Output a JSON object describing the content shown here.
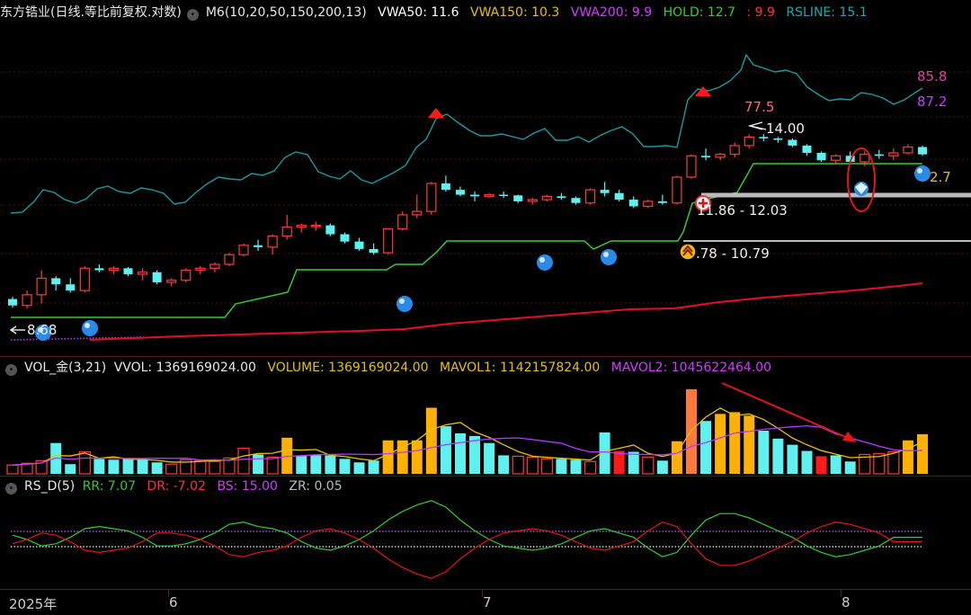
{
  "main_header": {
    "title": "东方锆业(日线.等比前复权.对数)",
    "m6": "M6(10,20,50,150,200,13)",
    "vwa50": "VWA50: 11.6",
    "vwa150": "VWA150: 10.3",
    "vwa200": "VWA200: 9.9",
    "hold": "HOLD: 12.7",
    "hold2": ": 9.9",
    "rsline": "RSLINE: 15.1",
    "colors": {
      "title": "#e8e8e8",
      "m6": "#e8e8e8",
      "vwa50": "#ffffff",
      "vwa150": "#e6c200",
      "vwa200": "#d23cff",
      "hold": "#33cc33",
      "hold2": "#ff3333",
      "rsline": "#1fa8a8"
    }
  },
  "vol_header": {
    "name": "VOL_金(3,21)",
    "vvol": "VVOL: 1369169024.00",
    "volume": "VOLUME: 1369169024.00",
    "mavol1": "MAVOL1: 1142157824.00",
    "mavol2": "MAVOL2: 1045622464.00",
    "colors": {
      "vvol": "#e8e8e8",
      "volume": "#e6c200",
      "mavol1": "#e6c200",
      "mavol2": "#d23cff"
    }
  },
  "rs_header": {
    "name": "RS_D(5)",
    "rr": "RR: 7.07",
    "dr": "DR: -7.02",
    "bs": "BS: 15.00",
    "zr": "ZR: 0.05",
    "colors": {
      "rr": "#33cc33",
      "dr": "#ff3333",
      "bs": "#d23cff",
      "zr": "#bbbbbb"
    }
  },
  "annotations": {
    "price_877": "77.5",
    "high_14": "14.00",
    "range_1": "11.86 - 12.03",
    "range_2": ".78 - 10.79",
    "low_868": "8.68",
    "rs_858": "85.8",
    "rs_872": "87.2",
    "right_27": "2.7"
  },
  "xaxis": {
    "labels": [
      "2025年",
      "6",
      "7",
      "8"
    ]
  },
  "chart_data": {
    "type": "candlestick",
    "candles": [
      [
        9.2,
        9.25,
        9.0,
        9.05
      ],
      [
        9.05,
        9.4,
        8.98,
        9.3
      ],
      [
        9.3,
        9.9,
        9.1,
        9.7
      ],
      [
        9.7,
        9.75,
        9.4,
        9.55
      ],
      [
        9.55,
        9.7,
        9.35,
        9.4
      ],
      [
        9.4,
        10.0,
        9.35,
        9.95
      ],
      [
        9.95,
        10.05,
        9.85,
        9.9
      ],
      [
        9.9,
        10.0,
        9.8,
        9.95
      ],
      [
        9.95,
        9.98,
        9.75,
        9.8
      ],
      [
        9.8,
        9.95,
        9.65,
        9.85
      ],
      [
        9.85,
        9.9,
        9.55,
        9.6
      ],
      [
        9.6,
        9.7,
        9.5,
        9.65
      ],
      [
        9.65,
        9.95,
        9.6,
        9.9
      ],
      [
        9.9,
        10.0,
        9.8,
        9.95
      ],
      [
        9.95,
        10.1,
        9.85,
        10.05
      ],
      [
        10.05,
        10.35,
        10.0,
        10.3
      ],
      [
        10.3,
        10.6,
        10.25,
        10.55
      ],
      [
        10.55,
        10.7,
        10.4,
        10.5
      ],
      [
        10.5,
        10.85,
        10.3,
        10.8
      ],
      [
        10.8,
        11.4,
        10.7,
        11.05
      ],
      [
        11.05,
        11.15,
        10.9,
        11.1
      ],
      [
        11.1,
        11.2,
        10.95,
        11.1
      ],
      [
        11.1,
        11.15,
        10.8,
        10.85
      ],
      [
        10.85,
        10.9,
        10.6,
        10.65
      ],
      [
        10.65,
        10.75,
        10.4,
        10.45
      ],
      [
        10.45,
        10.6,
        10.3,
        10.35
      ],
      [
        10.35,
        11.0,
        10.3,
        11.0
      ],
      [
        11.0,
        11.5,
        10.95,
        11.4
      ],
      [
        11.4,
        12.0,
        11.3,
        11.5
      ],
      [
        11.5,
        12.4,
        11.4,
        12.35
      ],
      [
        12.35,
        12.6,
        12.1,
        12.15
      ],
      [
        12.15,
        12.25,
        11.95,
        12.0
      ],
      [
        12.0,
        12.1,
        11.8,
        11.95
      ],
      [
        11.95,
        12.05,
        11.9,
        12.0
      ],
      [
        12.0,
        12.1,
        11.9,
        11.98
      ],
      [
        11.98,
        12.0,
        11.75,
        11.8
      ],
      [
        11.8,
        11.9,
        11.7,
        11.85
      ],
      [
        11.85,
        12.0,
        11.8,
        11.95
      ],
      [
        11.95,
        12.05,
        11.85,
        11.9
      ],
      [
        11.9,
        11.95,
        11.7,
        11.75
      ],
      [
        11.75,
        12.2,
        11.7,
        12.15
      ],
      [
        12.15,
        12.4,
        11.95,
        12.05
      ],
      [
        12.05,
        12.15,
        11.8,
        11.85
      ],
      [
        11.85,
        11.95,
        11.6,
        11.65
      ],
      [
        11.65,
        11.85,
        11.6,
        11.8
      ],
      [
        11.8,
        12.0,
        11.7,
        11.75
      ],
      [
        11.75,
        12.6,
        11.7,
        12.55
      ],
      [
        12.55,
        13.3,
        12.5,
        13.25
      ],
      [
        13.25,
        13.5,
        13.1,
        13.2
      ],
      [
        13.2,
        13.35,
        13.1,
        13.3
      ],
      [
        13.3,
        13.7,
        13.2,
        13.6
      ],
      [
        13.6,
        14.0,
        13.5,
        13.9
      ],
      [
        13.9,
        14.0,
        13.75,
        13.85
      ],
      [
        13.85,
        13.9,
        13.7,
        13.8
      ],
      [
        13.8,
        13.85,
        13.55,
        13.6
      ],
      [
        13.6,
        13.65,
        13.25,
        13.35
      ],
      [
        13.35,
        13.4,
        13.05,
        13.1
      ],
      [
        13.1,
        13.3,
        12.95,
        13.25
      ],
      [
        13.25,
        13.4,
        13.0,
        13.05
      ],
      [
        13.05,
        13.4,
        12.9,
        13.3
      ],
      [
        13.3,
        13.45,
        13.15,
        13.25
      ],
      [
        13.25,
        13.5,
        13.1,
        13.35
      ],
      [
        13.35,
        13.65,
        13.3,
        13.55
      ],
      [
        13.55,
        13.6,
        13.25,
        13.3
      ]
    ],
    "volume_up": [
      true,
      true,
      true,
      false,
      false,
      true,
      false,
      false,
      false,
      false,
      false,
      true,
      true,
      true,
      true,
      true,
      true,
      false,
      true,
      true,
      false,
      false,
      false,
      false,
      false,
      false,
      true,
      true,
      true,
      true,
      false,
      false,
      false,
      false,
      false,
      true,
      true,
      true,
      false,
      false,
      true,
      false,
      false,
      false,
      true,
      false,
      true,
      true,
      false,
      true,
      true,
      true,
      false,
      false,
      false,
      false,
      false,
      false,
      false,
      true,
      true,
      true,
      true,
      true
    ],
    "volume_values": [
      1.0,
      1.2,
      1.5,
      3.5,
      1.1,
      2.5,
      1.7,
      1.6,
      1.7,
      1.6,
      1.3,
      1.1,
      1.6,
      1.5,
      1.4,
      1.8,
      2.9,
      2.2,
      1.9,
      4.1,
      2.1,
      2.1,
      2.1,
      1.7,
      1.3,
      1.5,
      3.8,
      3.8,
      3.8,
      7.5,
      5.4,
      4.6,
      4.3,
      3.5,
      2.1,
      2.0,
      1.9,
      1.7,
      1.7,
      1.6,
      1.4,
      4.7,
      2.6,
      2.5,
      1.9,
      1.5,
      3.7,
      9.6,
      6.0,
      6.8,
      7.0,
      6.6,
      4.9,
      4.0,
      3.3,
      2.6,
      2.0,
      2.1,
      1.4,
      2.2,
      2.3,
      2.5,
      3.8,
      4.5
    ],
    "rs_rr": [
      0.2,
      0.0,
      -0.3,
      -0.2,
      0.1,
      0.5,
      0.6,
      0.5,
      0.4,
      0.1,
      -0.3,
      -0.3,
      -0.2,
      0.0,
      0.3,
      0.7,
      0.8,
      0.6,
      0.5,
      0.3,
      -0.1,
      -0.4,
      -0.5,
      -0.3,
      0.0,
      0.4,
      0.9,
      1.3,
      1.6,
      1.8,
      1.5,
      0.9,
      0.4,
      0.0,
      -0.3,
      -0.4,
      -0.5,
      -0.4,
      -0.2,
      0.1,
      0.4,
      0.5,
      0.3,
      0.1,
      -0.4,
      -0.8,
      -0.6,
      0.2,
      0.9,
      1.2,
      1.2,
      1.0,
      0.7,
      0.4,
      0.1,
      -0.3,
      -0.6,
      -0.8,
      -0.7,
      -0.5,
      -0.3,
      0.1,
      0.1,
      0.1
    ],
    "rs_dr": [
      -0.2,
      0.0,
      0.3,
      0.2,
      -0.1,
      -0.5,
      -0.6,
      -0.5,
      -0.4,
      -0.1,
      0.3,
      0.3,
      0.2,
      0.0,
      -0.3,
      -0.7,
      -0.8,
      -0.6,
      -0.5,
      -0.3,
      0.1,
      0.4,
      0.5,
      0.3,
      0.0,
      -0.4,
      -0.9,
      -1.3,
      -1.6,
      -1.8,
      -1.5,
      -0.9,
      -0.4,
      0.0,
      0.3,
      0.4,
      0.5,
      0.4,
      0.2,
      -0.1,
      -0.4,
      -0.5,
      -0.3,
      -0.1,
      0.4,
      0.8,
      0.6,
      -0.2,
      -0.9,
      -1.2,
      -1.2,
      -1.0,
      -0.7,
      -0.4,
      -0.1,
      0.3,
      0.6,
      0.8,
      0.7,
      0.5,
      0.3,
      -0.1,
      -0.1,
      -0.1
    ]
  }
}
